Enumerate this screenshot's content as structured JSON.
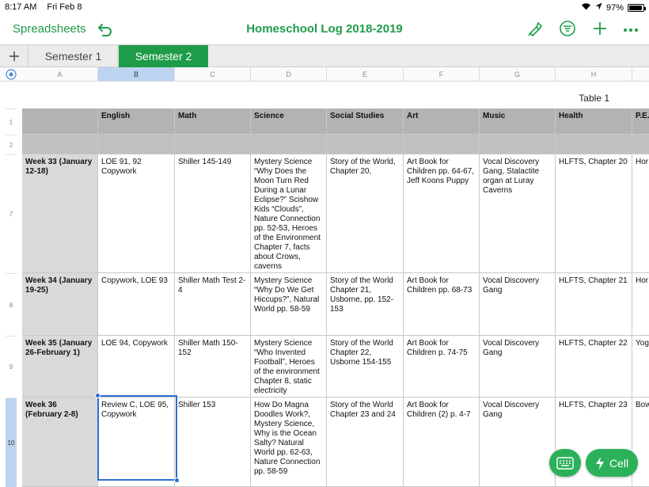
{
  "status": {
    "time": "8:17 AM",
    "date": "Fri Feb 8",
    "battery": "97%",
    "battery_level": 0.97
  },
  "toolbar": {
    "back_label": "Spreadsheets",
    "title": "Homeschool Log 2018-2019"
  },
  "tabs": [
    {
      "label": "Semester 1",
      "active": false
    },
    {
      "label": "Semester 2",
      "active": true
    }
  ],
  "column_letters": [
    "A",
    "B",
    "C",
    "D",
    "E",
    "F",
    "G",
    "H"
  ],
  "selected_column": "B",
  "row_numbers": [
    "1",
    "2",
    "7",
    "8",
    "9",
    "10"
  ],
  "selected_row": "10",
  "table": {
    "name": "Table 1",
    "headers": [
      "",
      "English",
      "Math",
      "Science",
      "Social Studies",
      "Art",
      "Music",
      "Health",
      "P.E."
    ],
    "rows": [
      [
        "Week 33 (January 12-18)",
        "LOE 91, 92 Copywork",
        "Shiller 145-149",
        "Mystery Science “Why Does the Moon Turn Red During a Lunar Eclipse?” Scishow Kids “Clouds”, Nature Connection pp. 52-53, Heroes of the Environment Chapter 7, facts about Crows, caverns",
        "Story of the World, Chapter 20,",
        "Art Book for Children pp. 64-67, Jeff Koons Puppy",
        "Vocal Discovery Gang, Stalactite organ at Luray Caverns",
        "HLFTS, Chapter 20",
        "Hor"
      ],
      [
        "Week 34 (January 19-25)",
        "Copywork, LOE 93",
        "Shiller Math Test 2-4",
        "Mystery Science “Why Do We Get Hiccups?”, Natural World pp. 58-59",
        "Story of the World Chapter 21, Usborne, pp. 152-153",
        "Art Book for Children pp. 68-73",
        "Vocal Discovery Gang",
        "HLFTS, Chapter 21",
        "Hor"
      ],
      [
        "Week 35 (January 26-February 1)",
        "LOE 94, Copywork",
        "Shiller Math 150-152",
        "Mystery Science “Who Invented Football”, Heroes of the environment Chapter 8, static electricity",
        "Story of the World Chapter 22, Usborne 154-155",
        "Art Book for Children p. 74-75",
        "Vocal Discovery Gang",
        "HLFTS, Chapter 22",
        "Yog"
      ],
      [
        "Week 36 (February 2-8)",
        "Review C, LOE 95, Copywork",
        "Shiller 153",
        "How Do Magna Doodles Work?, Mystery Science, Why is the Ocean Salty? Natural World pp. 62-63, Nature Connection pp. 58-59",
        "Story of the World Chapter 23 and 24",
        "Art Book for Children (2) p. 4-7",
        "Vocal Discovery Gang",
        "HLFTS, Chapter 23",
        "Bow"
      ]
    ]
  },
  "buttons": {
    "cell_label": "Cell"
  },
  "colors": {
    "accent": "#1f9c4a",
    "selection": "#2f6fd6",
    "header_fill": "#b3b3b3"
  }
}
